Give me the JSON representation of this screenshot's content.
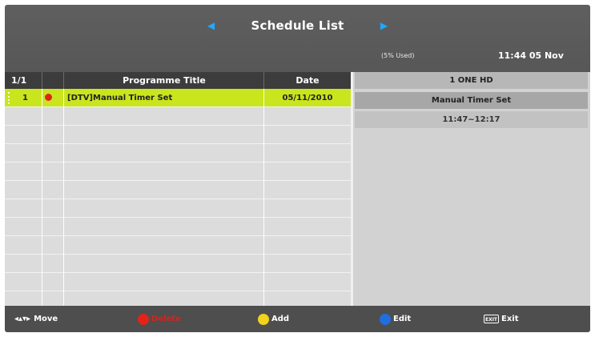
{
  "header": {
    "title": "Schedule List",
    "storage_used": "(5% Used)",
    "clock": "11:44 05 Nov",
    "accent_color": "#1ea9ff"
  },
  "table": {
    "headers": {
      "count": "1/1",
      "title": "Programme Title",
      "date": "Date"
    },
    "rows": [
      {
        "num": "1",
        "icon": "record-icon",
        "title": "[DTV]Manual Timer Set",
        "date": "05/11/2010",
        "selected": true
      }
    ],
    "selected_color": "#c9e51d"
  },
  "detail": {
    "channel": "1 ONE HD",
    "event": "Manual Timer Set",
    "time": "11:47~12:17"
  },
  "footer": {
    "move_label": "Move",
    "delete_label": "Delete",
    "add_label": "Add",
    "edit_label": "Edit",
    "exit_label": "Exit",
    "colors": {
      "red": "#e2231a",
      "yellow": "#f2d21b",
      "blue": "#1f6fe0"
    }
  }
}
